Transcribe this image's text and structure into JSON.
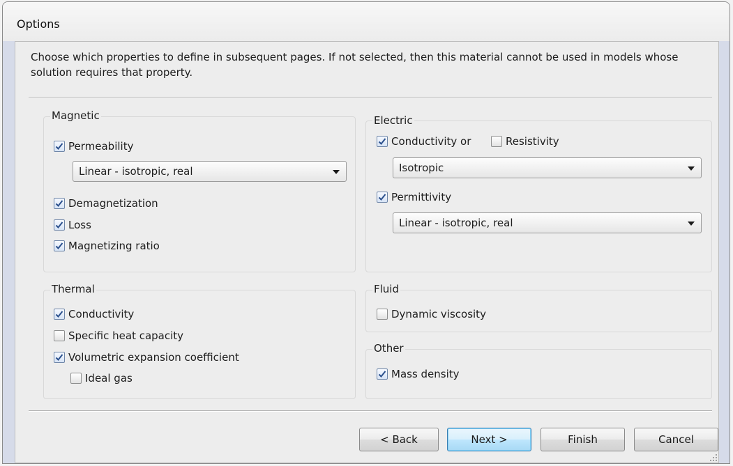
{
  "window": {
    "title": "Options"
  },
  "description": "Choose which properties to define in subsequent pages. If not selected, then this material cannot be used in models whose solution requires that property.",
  "magnetic": {
    "title": "Magnetic",
    "permeability": {
      "label": "Permeability",
      "checked": true
    },
    "permeability_select": "Linear - isotropic, real",
    "demagnetization": {
      "label": "Demagnetization",
      "checked": true
    },
    "loss": {
      "label": "Loss",
      "checked": true
    },
    "magnetizing_ratio": {
      "label": "Magnetizing ratio",
      "checked": true
    }
  },
  "electric": {
    "title": "Electric",
    "conductivity": {
      "label": "Conductivity or",
      "checked": true
    },
    "resistivity": {
      "label": "Resistivity",
      "checked": false
    },
    "conductivity_select": "Isotropic",
    "permittivity": {
      "label": "Permittivity",
      "checked": true
    },
    "permittivity_select": "Linear - isotropic, real"
  },
  "thermal": {
    "title": "Thermal",
    "conductivity": {
      "label": "Conductivity",
      "checked": true
    },
    "specific_heat": {
      "label": "Specific heat capacity",
      "checked": false
    },
    "volumetric_expansion": {
      "label": "Volumetric expansion coefficient",
      "checked": true
    },
    "ideal_gas": {
      "label": "Ideal gas",
      "checked": false
    }
  },
  "fluid": {
    "title": "Fluid",
    "dynamic_viscosity": {
      "label": "Dynamic viscosity",
      "checked": false
    }
  },
  "other": {
    "title": "Other",
    "mass_density": {
      "label": "Mass density",
      "checked": true
    }
  },
  "buttons": {
    "back": "< Back",
    "next": "Next >",
    "finish": "Finish",
    "cancel": "Cancel"
  },
  "icons": {
    "checkmark": "check-icon",
    "dropdown": "chevron-down-icon",
    "resize": "resize-grip-icon"
  },
  "colors": {
    "checkmark": "#2a4f8c",
    "default_button_border": "#3c7fb1",
    "window_frame": "#d6dbe9"
  }
}
